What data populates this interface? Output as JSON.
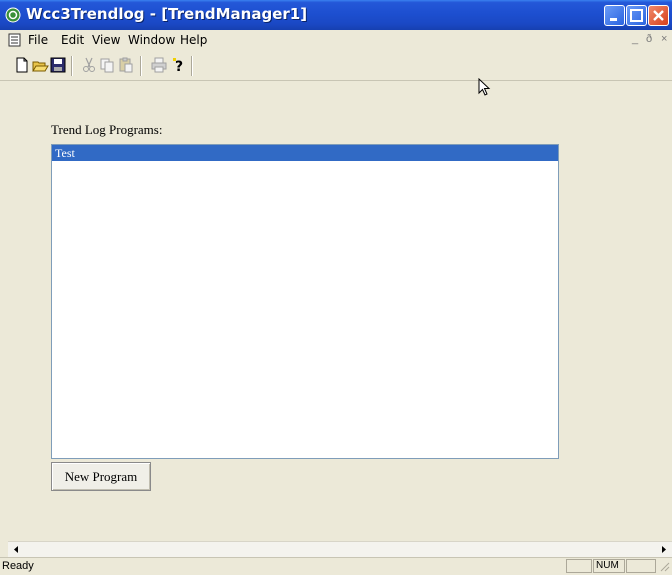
{
  "window": {
    "title": "Wcc3Trendlog - [TrendManager1]"
  },
  "menubar": {
    "items": [
      "File",
      "Edit",
      "View",
      "Window",
      "Help"
    ],
    "mdi_minimize": "_",
    "mdi_restore": "ð",
    "mdi_close": "×"
  },
  "toolbar": {
    "icons": [
      "new-file-icon",
      "open-folder-icon",
      "save-disk-icon",
      "cut-scissors-icon",
      "copy-icon",
      "paste-icon",
      "print-icon",
      "help-icon"
    ]
  },
  "main": {
    "programs_label": "Trend Log Programs:",
    "programs": [
      {
        "label": "Test",
        "selected": true
      }
    ],
    "new_program_button": "New Program"
  },
  "statusbar": {
    "text": "Ready",
    "num_indicator": "NUM"
  },
  "colors": {
    "titlebar": "#1d4fd0",
    "selection": "#316ac5",
    "face": "#ece9d8"
  }
}
